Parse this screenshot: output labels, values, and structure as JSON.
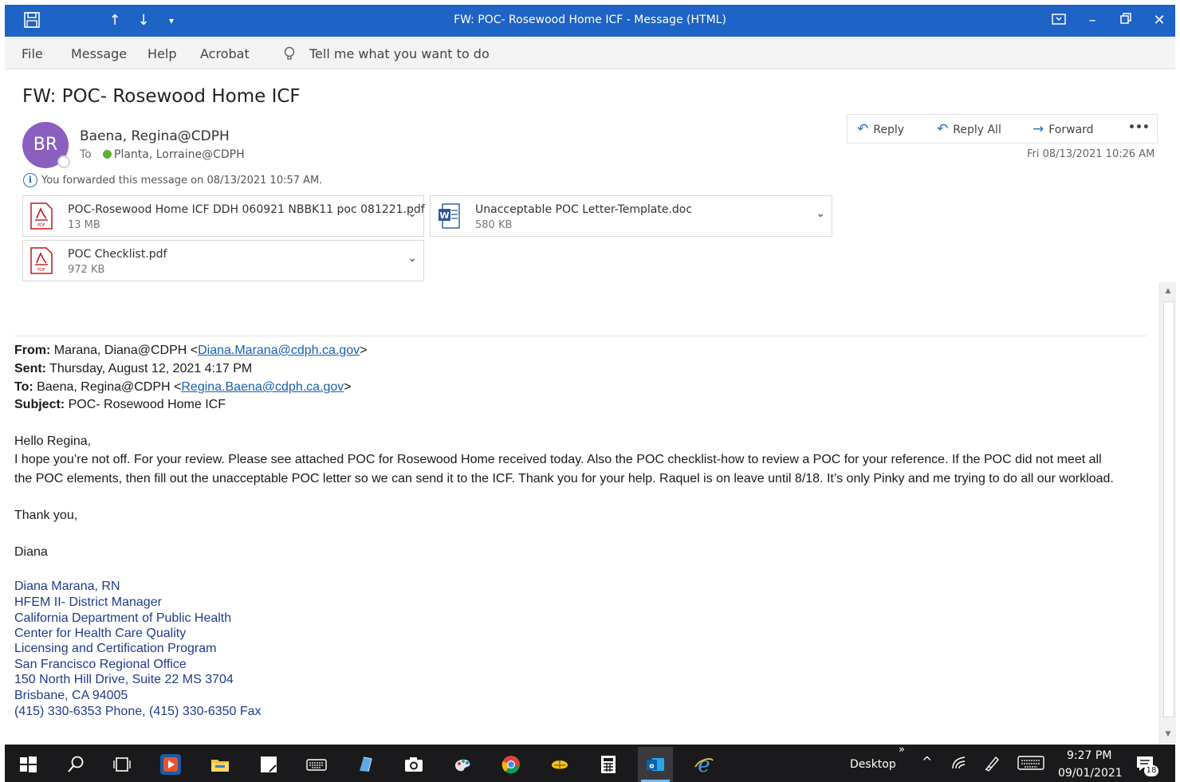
{
  "window": {
    "title": "FW: POC- Rosewood Home ICF  -  Message (HTML)"
  },
  "menu": [
    "File",
    "Message",
    "Help",
    "Acrobat"
  ],
  "tell_me": "Tell me what you want to do",
  "header": {
    "subject": "FW: POC- Rosewood Home ICF",
    "avatar_initials": "BR",
    "sender": "Baena, Regina@CDPH",
    "to_label": "To",
    "to_name": "Planta, Lorraine@CDPH",
    "info": "You forwarded this message on 08/13/2021 10:57 AM.",
    "date": "Fri 08/13/2021 10:26 AM"
  },
  "actions": {
    "reply": "Reply",
    "reply_all": "Reply All",
    "forward": "Forward",
    "more": "•••"
  },
  "attachments": [
    {
      "name": "POC-Rosewood Home ICF DDH 060921 NBBK11 poc 081221.pdf",
      "size": "13 MB",
      "type": "pdf"
    },
    {
      "name": "Unacceptable POC Letter-Template.doc",
      "size": "580 KB",
      "type": "word"
    },
    {
      "name": "POC Checklist.pdf",
      "size": "972 KB",
      "type": "pdf"
    }
  ],
  "forwarded": {
    "from_label": "From:",
    "from_name": " Marana, Diana@CDPH <",
    "from_email": "Diana.Marana@cdph.ca.gov",
    "from_end": ">",
    "sent_label": "Sent:",
    "sent": " Thursday, August 12, 2021 4:17 PM",
    "to_label": "To:",
    "to_name": " Baena, Regina@CDPH <",
    "to_email": "Regina.Baena@cdph.ca.gov",
    "to_end": ">",
    "subject_label": "Subject:",
    "subject": " POC- Rosewood Home ICF"
  },
  "body": {
    "greeting": "Hello Regina,",
    "line1": "I hope you’re not off. For your review. Please see attached POC for Rosewood Home received today. Also the POC checklist-how to review a POC for your reference. If the POC did not meet all",
    "line2": "the POC elements, then fill out the unacceptable POC letter so we can send it to the ICF. Thank you for your help. Raquel is on leave until 8/18. It’s only Pinky and me trying to do all our workload.",
    "thanks": "Thank you,",
    "name": "Diana"
  },
  "signature": [
    "Diana Marana, RN",
    "HFEM II- District Manager",
    "California Department of Public Health",
    "Center for Health Care Quality",
    "Licensing and Certification Program",
    "San Francisco Regional Office",
    "150 North Hill Drive, Suite 22  MS 3704",
    "Brisbane, CA 94005",
    "(415) 330-6353 Phone, (415) 330-6350 Fax"
  ],
  "taskbar": {
    "desktop": "Desktop",
    "overflow": "»",
    "time": "9:27 PM",
    "date": "09/01/2021",
    "notifications": "18"
  }
}
